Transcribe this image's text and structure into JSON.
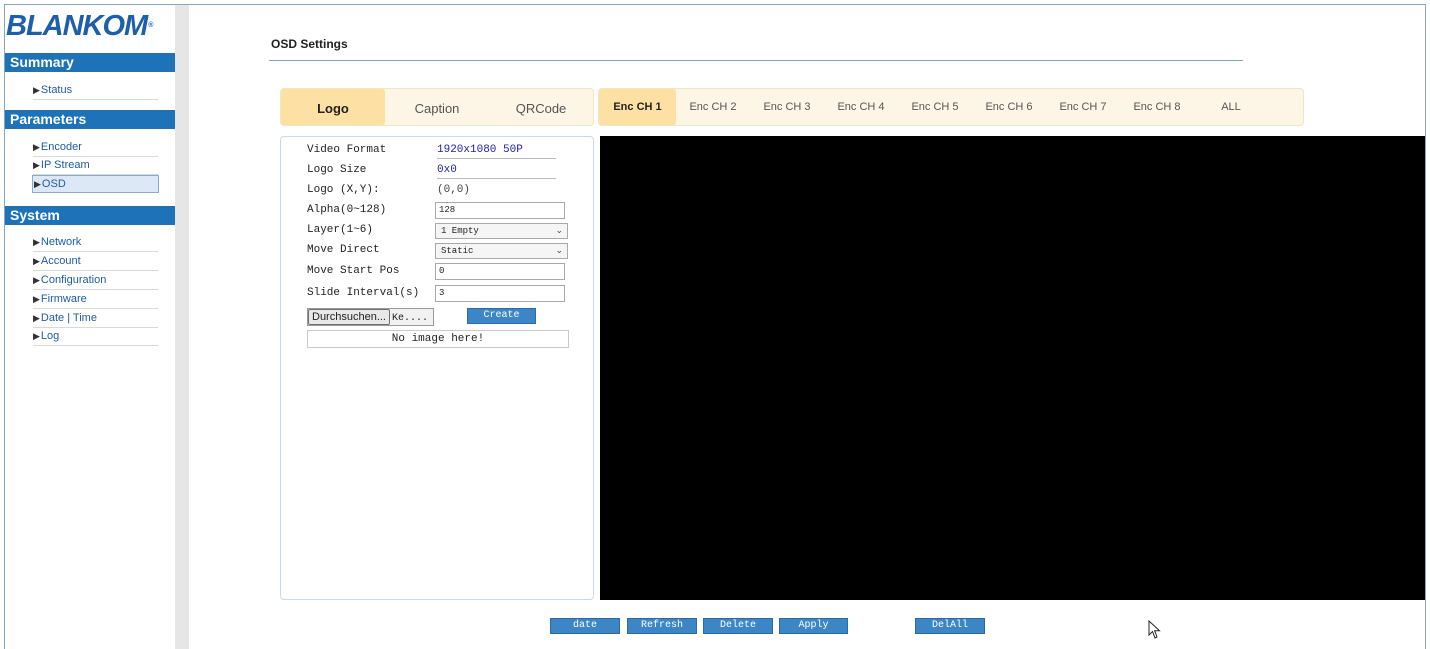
{
  "brand": {
    "logo_text": "BLANKOM",
    "registered": "®"
  },
  "sidebar": {
    "sections": [
      {
        "title": "Summary",
        "items": [
          {
            "label": "Status"
          }
        ]
      },
      {
        "title": "Parameters",
        "items": [
          {
            "label": "Encoder"
          },
          {
            "label": "IP Stream"
          },
          {
            "label": "OSD",
            "active": true
          }
        ]
      },
      {
        "title": "System",
        "items": [
          {
            "label": "Network"
          },
          {
            "label": "Account"
          },
          {
            "label": "Configuration"
          },
          {
            "label": "Firmware"
          },
          {
            "label": "Date | Time"
          },
          {
            "label": "Log"
          }
        ]
      }
    ]
  },
  "page": {
    "title": "OSD Settings"
  },
  "tabs": [
    {
      "label": "Logo",
      "active": true
    },
    {
      "label": "Caption"
    },
    {
      "label": "QRCode"
    }
  ],
  "channels": [
    {
      "label": "Enc CH 1",
      "active": true
    },
    {
      "label": "Enc CH 2"
    },
    {
      "label": "Enc CH 3"
    },
    {
      "label": "Enc CH 4"
    },
    {
      "label": "Enc CH 5"
    },
    {
      "label": "Enc CH 6"
    },
    {
      "label": "Enc CH 7"
    },
    {
      "label": "Enc CH 8"
    },
    {
      "label": "ALL"
    }
  ],
  "form": {
    "video_format_label": "Video Format",
    "video_format_value": "1920x1080 50P",
    "logo_size_label": "Logo Size",
    "logo_size_value": "0x0",
    "logo_xy_label": "Logo (X,Y):",
    "logo_xy_value": "(0,0)",
    "alpha_label": "Alpha(0~128)",
    "alpha_value": "128",
    "layer_label": "Layer(1~6)",
    "layer_value": "1 Empty",
    "move_direct_label": "Move Direct",
    "move_direct_value": "Static",
    "move_start_label": "Move Start Pos",
    "move_start_value": "0",
    "slide_interval_label": "Slide Interval(s)",
    "slide_interval_value": "3",
    "browse_label": "Durchsuchen...",
    "browse_file": "Ke....",
    "create_label": "Create",
    "no_image": "No image here!"
  },
  "actions": {
    "date": "date",
    "refresh": "Refresh",
    "delete": "Delete",
    "apply": "Apply",
    "delall": "DelAll"
  },
  "colors": {
    "accent": "#1e73b8",
    "tab_active": "#fde0a3",
    "tab_bg": "#fdf6e6",
    "button": "#3d86c6",
    "preview": "#000000"
  }
}
